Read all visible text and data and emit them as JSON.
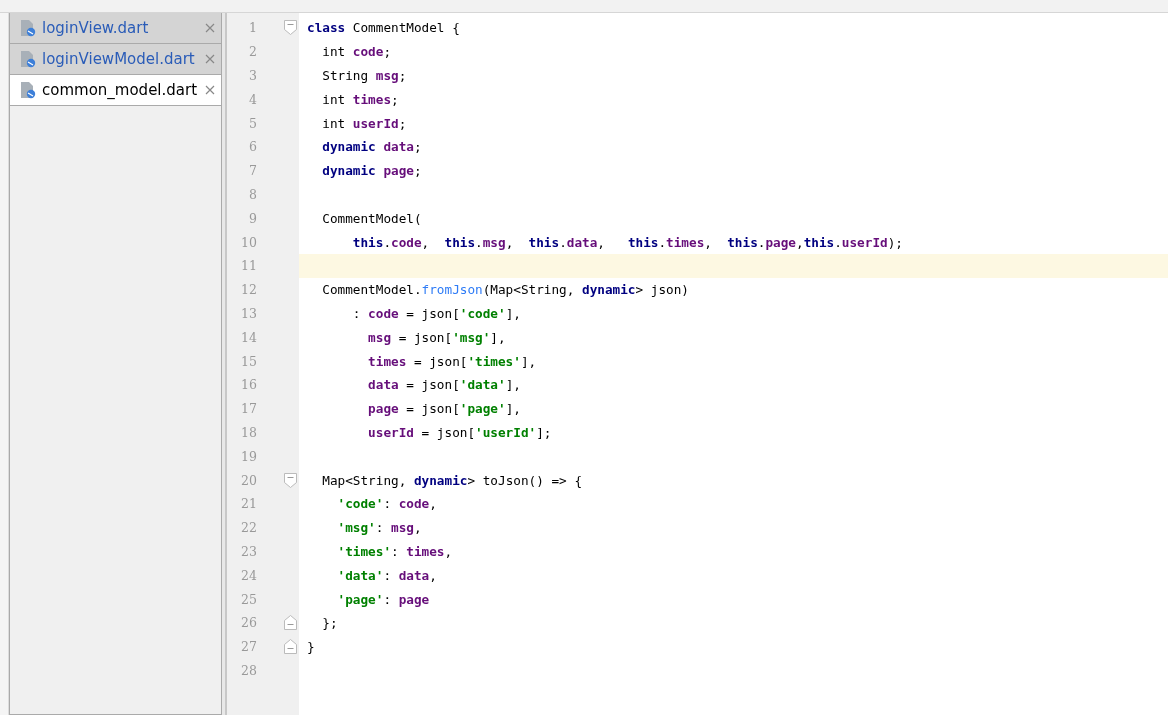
{
  "tabs": [
    {
      "label": "loginView.dart",
      "selected": false
    },
    {
      "label": "loginViewModel.dart",
      "selected": false
    },
    {
      "label": "common_model.dart",
      "selected": true
    }
  ],
  "editor": {
    "lines": [
      {
        "number": "1",
        "current": false,
        "fold_marker": {
          "kind": "start"
        },
        "tokens": [
          {
            "kind": "kw",
            "text": "class"
          },
          {
            "kind": "plain",
            "text": " CommentModel {"
          }
        ]
      },
      {
        "number": "2",
        "current": false,
        "tokens": [
          {
            "kind": "plain",
            "text": "  int "
          },
          {
            "kind": "field",
            "text": "code"
          },
          {
            "kind": "plain",
            "text": ";"
          }
        ]
      },
      {
        "number": "3",
        "current": false,
        "tokens": [
          {
            "kind": "plain",
            "text": "  String "
          },
          {
            "kind": "field",
            "text": "msg"
          },
          {
            "kind": "plain",
            "text": ";"
          }
        ]
      },
      {
        "number": "4",
        "current": false,
        "tokens": [
          {
            "kind": "plain",
            "text": "  int "
          },
          {
            "kind": "field",
            "text": "times"
          },
          {
            "kind": "plain",
            "text": ";"
          }
        ]
      },
      {
        "number": "5",
        "current": false,
        "tokens": [
          {
            "kind": "plain",
            "text": "  int "
          },
          {
            "kind": "field",
            "text": "userId"
          },
          {
            "kind": "plain",
            "text": ";"
          }
        ]
      },
      {
        "number": "6",
        "current": false,
        "tokens": [
          {
            "kind": "kw",
            "text": "  dynamic"
          },
          {
            "kind": "field",
            "text": " data"
          },
          {
            "kind": "plain",
            "text": ";"
          }
        ]
      },
      {
        "number": "7",
        "current": false,
        "tokens": [
          {
            "kind": "kw",
            "text": "  dynamic"
          },
          {
            "kind": "field",
            "text": " page"
          },
          {
            "kind": "plain",
            "text": ";"
          }
        ]
      },
      {
        "number": "8",
        "current": false
      },
      {
        "number": "9",
        "current": false,
        "tokens": [
          {
            "kind": "plain",
            "text": "  CommentModel("
          }
        ]
      },
      {
        "number": "10",
        "current": false,
        "tokens": [
          {
            "kind": "kw",
            "text": "      this"
          },
          {
            "kind": "plain",
            "text": "."
          },
          {
            "kind": "field",
            "text": "code"
          },
          {
            "kind": "plain",
            "text": ",  "
          },
          {
            "kind": "kw",
            "text": "this"
          },
          {
            "kind": "plain",
            "text": "."
          },
          {
            "kind": "field",
            "text": "msg"
          },
          {
            "kind": "plain",
            "text": ",  "
          },
          {
            "kind": "kw",
            "text": "this"
          },
          {
            "kind": "plain",
            "text": "."
          },
          {
            "kind": "field",
            "text": "data"
          },
          {
            "kind": "plain",
            "text": ",   "
          },
          {
            "kind": "kw",
            "text": "this"
          },
          {
            "kind": "plain",
            "text": "."
          },
          {
            "kind": "field",
            "text": "times"
          },
          {
            "kind": "plain",
            "text": ",  "
          },
          {
            "kind": "kw",
            "text": "this"
          },
          {
            "kind": "plain",
            "text": "."
          },
          {
            "kind": "field",
            "text": "page"
          },
          {
            "kind": "plain",
            "text": ","
          },
          {
            "kind": "kw",
            "text": "this"
          },
          {
            "kind": "plain",
            "text": "."
          },
          {
            "kind": "field",
            "text": "userId"
          },
          {
            "kind": "plain",
            "text": ");"
          }
        ]
      },
      {
        "number": "11",
        "current": true
      },
      {
        "number": "12",
        "current": false,
        "tokens": [
          {
            "kind": "plain",
            "text": "  CommentModel."
          },
          {
            "kind": "fn",
            "text": "fromJson"
          },
          {
            "kind": "plain",
            "text": "(Map<String, "
          },
          {
            "kind": "kw",
            "text": "dynamic"
          },
          {
            "kind": "plain",
            "text": "> json)"
          }
        ]
      },
      {
        "number": "13",
        "current": false,
        "tokens": [
          {
            "kind": "plain",
            "text": "      : "
          },
          {
            "kind": "field",
            "text": "code"
          },
          {
            "kind": "plain",
            "text": " = json["
          },
          {
            "kind": "str",
            "text": "'code'"
          },
          {
            "kind": "plain",
            "text": "],"
          }
        ]
      },
      {
        "number": "14",
        "current": false,
        "tokens": [
          {
            "kind": "field",
            "text": "        msg"
          },
          {
            "kind": "plain",
            "text": " = json["
          },
          {
            "kind": "str",
            "text": "'msg'"
          },
          {
            "kind": "plain",
            "text": "],"
          }
        ]
      },
      {
        "number": "15",
        "current": false,
        "tokens": [
          {
            "kind": "field",
            "text": "        times"
          },
          {
            "kind": "plain",
            "text": " = json["
          },
          {
            "kind": "str",
            "text": "'times'"
          },
          {
            "kind": "plain",
            "text": "],"
          }
        ]
      },
      {
        "number": "16",
        "current": false,
        "tokens": [
          {
            "kind": "field",
            "text": "        data"
          },
          {
            "kind": "plain",
            "text": " = json["
          },
          {
            "kind": "str",
            "text": "'data'"
          },
          {
            "kind": "plain",
            "text": "],"
          }
        ]
      },
      {
        "number": "17",
        "current": false,
        "tokens": [
          {
            "kind": "field",
            "text": "        page"
          },
          {
            "kind": "plain",
            "text": " = json["
          },
          {
            "kind": "str",
            "text": "'page'"
          },
          {
            "kind": "plain",
            "text": "],"
          }
        ]
      },
      {
        "number": "18",
        "current": false,
        "tokens": [
          {
            "kind": "field",
            "text": "        userId"
          },
          {
            "kind": "plain",
            "text": " = json["
          },
          {
            "kind": "str",
            "text": "'userId'"
          },
          {
            "kind": "plain",
            "text": "];"
          }
        ]
      },
      {
        "number": "19",
        "current": false
      },
      {
        "number": "20",
        "current": false,
        "fold_marker": {
          "kind": "start"
        },
        "tokens": [
          {
            "kind": "plain",
            "text": "  Map<String, "
          },
          {
            "kind": "kw",
            "text": "dynamic"
          },
          {
            "kind": "plain",
            "text": "> toJson() => {"
          }
        ]
      },
      {
        "number": "21",
        "current": false,
        "tokens": [
          {
            "kind": "str",
            "text": "    'code'"
          },
          {
            "kind": "plain",
            "text": ": "
          },
          {
            "kind": "field",
            "text": "code"
          },
          {
            "kind": "plain",
            "text": ","
          }
        ]
      },
      {
        "number": "22",
        "current": false,
        "tokens": [
          {
            "kind": "str",
            "text": "    'msg'"
          },
          {
            "kind": "plain",
            "text": ": "
          },
          {
            "kind": "field",
            "text": "msg"
          },
          {
            "kind": "plain",
            "text": ","
          }
        ]
      },
      {
        "number": "23",
        "current": false,
        "tokens": [
          {
            "kind": "str",
            "text": "    'times'"
          },
          {
            "kind": "plain",
            "text": ": "
          },
          {
            "kind": "field",
            "text": "times"
          },
          {
            "kind": "plain",
            "text": ","
          }
        ]
      },
      {
        "number": "24",
        "current": false,
        "tokens": [
          {
            "kind": "str",
            "text": "    'data'"
          },
          {
            "kind": "plain",
            "text": ": "
          },
          {
            "kind": "field",
            "text": "data"
          },
          {
            "kind": "plain",
            "text": ","
          }
        ]
      },
      {
        "number": "25",
        "current": false,
        "tokens": [
          {
            "kind": "str",
            "text": "    'page'"
          },
          {
            "kind": "plain",
            "text": ": "
          },
          {
            "kind": "field",
            "text": "page"
          }
        ]
      },
      {
        "number": "26",
        "current": false,
        "fold_marker": {
          "kind": "end"
        },
        "tokens": [
          {
            "kind": "plain",
            "text": "  };"
          }
        ]
      },
      {
        "number": "27",
        "current": false,
        "fold_marker": {
          "kind": "end"
        },
        "tokens": [
          {
            "kind": "plain",
            "text": "}"
          }
        ]
      },
      {
        "number": "28",
        "current": false
      }
    ]
  }
}
